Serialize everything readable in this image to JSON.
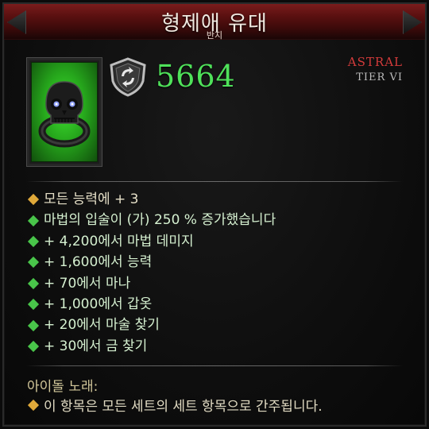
{
  "item": {
    "name": "형제애 유대",
    "type": "반지",
    "power": "5664",
    "rarity": "ASTRAL",
    "tier": "TIER VI"
  },
  "affixes": [
    {
      "text": "모든 능력에 + 3",
      "bullet": "gold"
    },
    {
      "text": "마법의 입술이 (가) 250 % 증가했습니다",
      "bullet": "green"
    },
    {
      "text": "+ 4,200에서 마법 데미지",
      "bullet": "green"
    },
    {
      "text": "+ 1,600에서 능력",
      "bullet": "green"
    },
    {
      "text": "+ 70에서 마나",
      "bullet": "green"
    },
    {
      "text": "+ 1,000에서 갑옷",
      "bullet": "green"
    },
    {
      "text": "+ 20에서 마술 찾기",
      "bullet": "green"
    },
    {
      "text": "+ 30에서 금 찾기",
      "bullet": "green"
    }
  ],
  "legend": {
    "header": "아이돌 노래:",
    "text": "이 항목은 모든 세트의 세트 항목으로 간주됩니다."
  },
  "colors": {
    "power": "#4fe25a",
    "rarity": "#d43b3b",
    "gold_bullet": "#e0a93a",
    "green_bullet": "#49c54a",
    "title_bar": "#5a1010",
    "item_bg": "#26a71c"
  },
  "icons": {
    "item": "skull-ring-icon",
    "power": "shield-swirl-icon"
  }
}
